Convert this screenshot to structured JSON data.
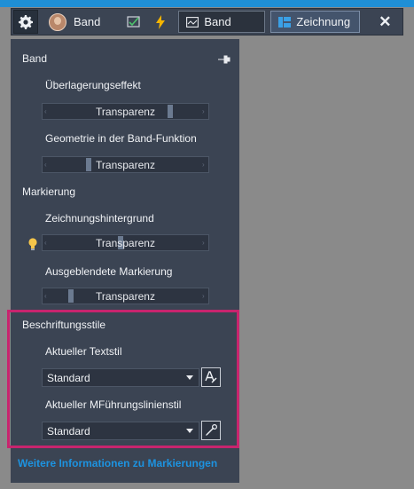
{
  "toolbar": {
    "user_label": "Band",
    "mode_band_label": "Band",
    "mode_drawing_label": "Zeichnung",
    "close_label": "✕"
  },
  "panel": {
    "band_section": {
      "title": "Band",
      "overlay_effect": {
        "label": "Überlagerungseffekt",
        "value_label": "Transparenz",
        "level": 0.78
      },
      "band_geometry": {
        "label": "Geometrie in der Band-Funktion",
        "value_label": "Transparenz",
        "level": 0.27
      }
    },
    "markup_section": {
      "title": "Markierung",
      "drawing_background": {
        "label": "Zeichnungshintergrund",
        "value_label": "Transparenz",
        "level": 0.47
      },
      "hidden_markup": {
        "label": "Ausgeblendete Markierung",
        "value_label": "Transparenz",
        "level": 0.16
      }
    },
    "annotation_section": {
      "title": "Beschriftungsstile",
      "text_style": {
        "label": "Aktueller Textstil",
        "value": "Standard"
      },
      "mleader_style": {
        "label": "Aktueller MFührungslinienstil",
        "value": "Standard"
      }
    },
    "more_info_link": "Weitere Informationen zu Markierungen"
  },
  "colors": {
    "accent": "#1f8fd6",
    "highlight": "#c8246e",
    "panel_bg": "#3b4453",
    "link": "#1d93e0"
  }
}
